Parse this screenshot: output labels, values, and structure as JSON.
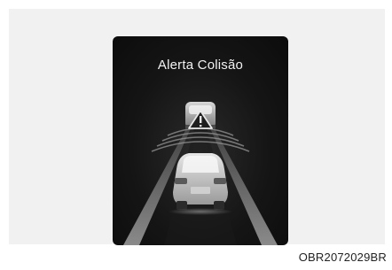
{
  "display": {
    "title": "Alerta Colisão"
  },
  "figure_code": "OBR2072029BR",
  "icons": {
    "lead_vehicle": "lead-vehicle-icon",
    "warning": "warning-triangle-icon",
    "own_vehicle": "own-vehicle-icon",
    "lanes": "lane-lines-icon"
  },
  "colors": {
    "screen_bg": "#111111",
    "panel_bg": "#f1f1f1",
    "text": "#f2f2f2"
  }
}
